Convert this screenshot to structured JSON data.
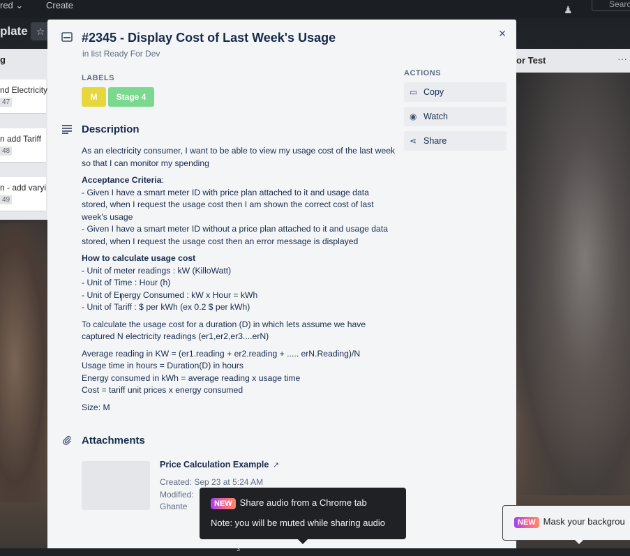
{
  "topbar": {
    "starred": "red",
    "create": "Create",
    "search": "Search",
    "board_title": "plate"
  },
  "background_lists": {
    "left_header": "g",
    "left_cards": [
      {
        "title": "nd Electricity",
        "badge": "47"
      },
      {
        "title": "n add Tariff",
        "badge": "48"
      },
      {
        "title": "n - add varyi",
        "badge": "49"
      }
    ],
    "right_header": "or Test"
  },
  "card": {
    "title": "#2345 - Display Cost of Last Week's Usage",
    "in_list_prefix": "in list ",
    "list_name": "Ready For Dev",
    "labels_heading": "LABELS",
    "labels": [
      {
        "text": "M",
        "color": "#e6d83a"
      },
      {
        "text": "Stage 4",
        "color": "#7bd88f"
      }
    ],
    "description_heading": "Description",
    "description": {
      "intro": "As an electricity consumer, I want to be able to view my usage cost of the last week so that I can monitor my spending",
      "acceptance_heading": "Acceptance Criteria",
      "acceptance_colon": ":",
      "acceptance_lines": [
        "- Given I have a smart meter ID with price plan attached to it and usage data stored, when I request the usage cost then I am shown the correct cost of last week's usage",
        "- Given I have a smart meter ID without a price plan attached to it and usage data stored, when I request the usage cost then an error message is displayed"
      ],
      "how_heading": "How to calculate usage cost",
      "units": [
        "- Unit of meter readings : kW (KilloWatt)",
        "- Unit of Time : Hour (h)",
        "- Unit of Energy Consumed : kW x Hour = kWh",
        "- Unit of Tariff : $ per kWh (ex 0.2 $ per kWh)"
      ],
      "calc_intro": "To calculate the usage cost for a duration (D) in which lets assume we have captured N electricity readings (er1,er2,er3....erN)",
      "formulas": [
        "Average reading in KW = (er1.reading + er2.reading + ..... erN.Reading)/N",
        "Usage time in hours = Duration(D) in hours",
        "Energy consumed in kWh = average reading x usage time",
        "Cost = tariff unit prices x energy consumed"
      ],
      "size": "Size: M"
    },
    "attachments_heading": "Attachments",
    "attachment": {
      "name": "Price Calculation Example",
      "arrow": "↗",
      "created": "Created: Sep 23 at 5:24 AM",
      "modified": "Modified:",
      "by": "Ghante"
    },
    "actions_heading": "ACTIONS",
    "actions": [
      {
        "label": "Copy",
        "icon": "card-icon"
      },
      {
        "label": "Watch",
        "icon": "eye-icon"
      },
      {
        "label": "Share",
        "icon": "share-icon"
      }
    ],
    "close": "×"
  },
  "tooltips": {
    "share_audio": {
      "badge": "NEW",
      "text": "Share audio from a Chrome tab",
      "note": "Note: you will be muted while sharing audio"
    },
    "mask": {
      "badge": "NEW",
      "text": "Mask your backgrou"
    }
  },
  "taskbar": {
    "count": "3"
  },
  "colors": {
    "modal_bg": "#f4f5f7",
    "action_bg": "#ebecf0",
    "label_yellow": "#e6d83a",
    "label_green": "#7bd88f",
    "text_primary": "#172b4d"
  }
}
